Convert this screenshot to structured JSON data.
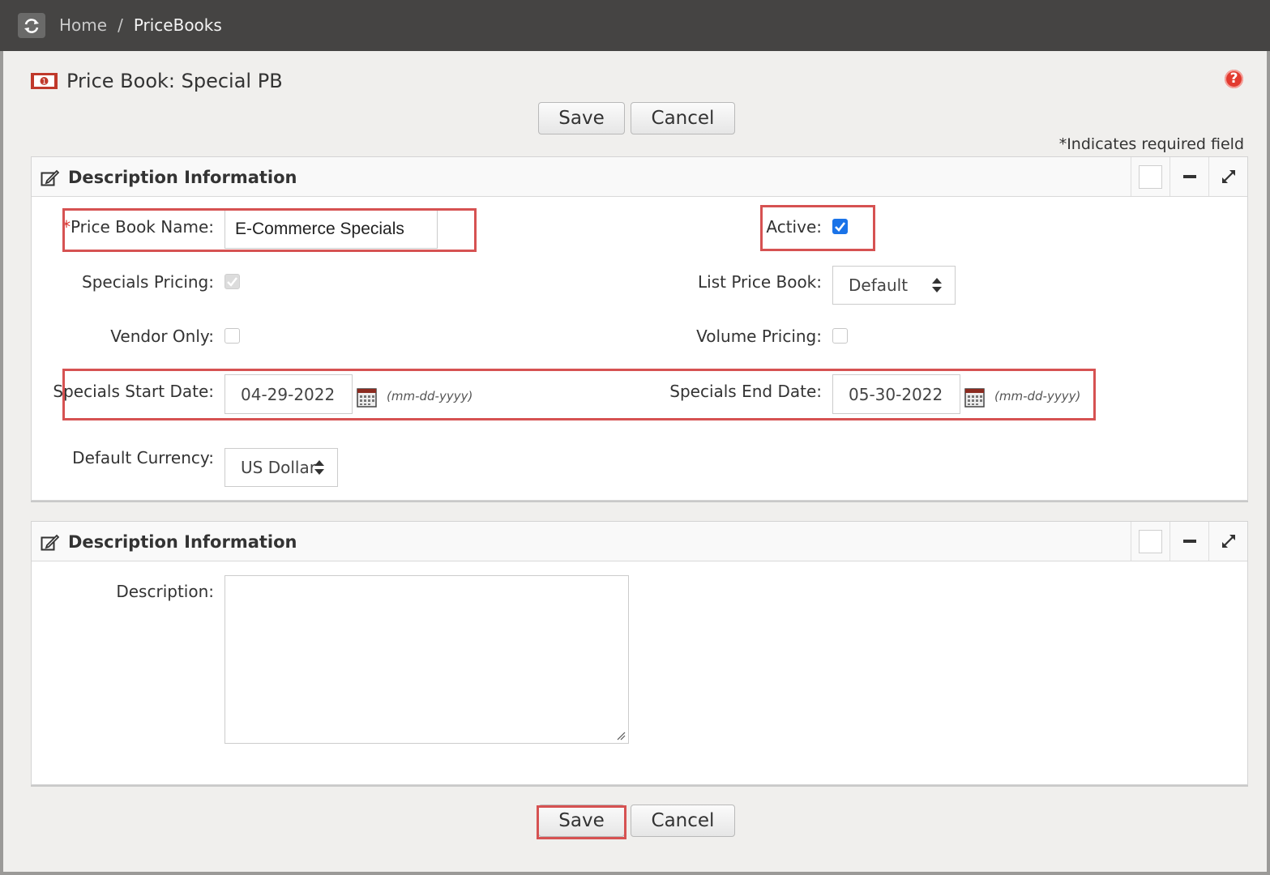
{
  "breadcrumb": {
    "home": "Home",
    "separator": "/",
    "current": "PriceBooks"
  },
  "page_title": "Price Book: Special PB",
  "buttons": {
    "save": "Save",
    "cancel": "Cancel"
  },
  "required_note": "*Indicates required field",
  "panel1": {
    "title": "Description Information",
    "fields": {
      "price_book_name": {
        "required_mark": "*",
        "label": "Price Book Name:",
        "value": "E-Commerce Specials"
      },
      "active": {
        "label": "Active:",
        "checked": true
      },
      "specials_pricing": {
        "label": "Specials Pricing:",
        "checked": true,
        "disabled": true
      },
      "list_price_book": {
        "label": "List Price Book:",
        "value": "Default"
      },
      "vendor_only": {
        "label": "Vendor Only:",
        "checked": false
      },
      "volume_pricing": {
        "label": "Volume Pricing:",
        "checked": false
      },
      "specials_start_date": {
        "label": "Specials Start Date:",
        "value": "04-29-2022",
        "format": "(mm-dd-yyyy)"
      },
      "specials_end_date": {
        "label": "Specials End Date:",
        "value": "05-30-2022",
        "format": "(mm-dd-yyyy)"
      },
      "default_currency": {
        "label": "Default Currency:",
        "value": "US Dollar"
      }
    }
  },
  "panel2": {
    "title": "Description Information",
    "fields": {
      "description": {
        "label": "Description:",
        "value": ""
      }
    }
  },
  "colors": {
    "highlight": "#d65252",
    "topbar": "#454443",
    "checkbox_checked": "#1a73e8"
  },
  "icons": [
    "refresh-icon",
    "price-book-icon",
    "help-icon",
    "edit-icon",
    "minus-icon",
    "expand-icon",
    "calendar-icon",
    "select-arrows-icon"
  ]
}
